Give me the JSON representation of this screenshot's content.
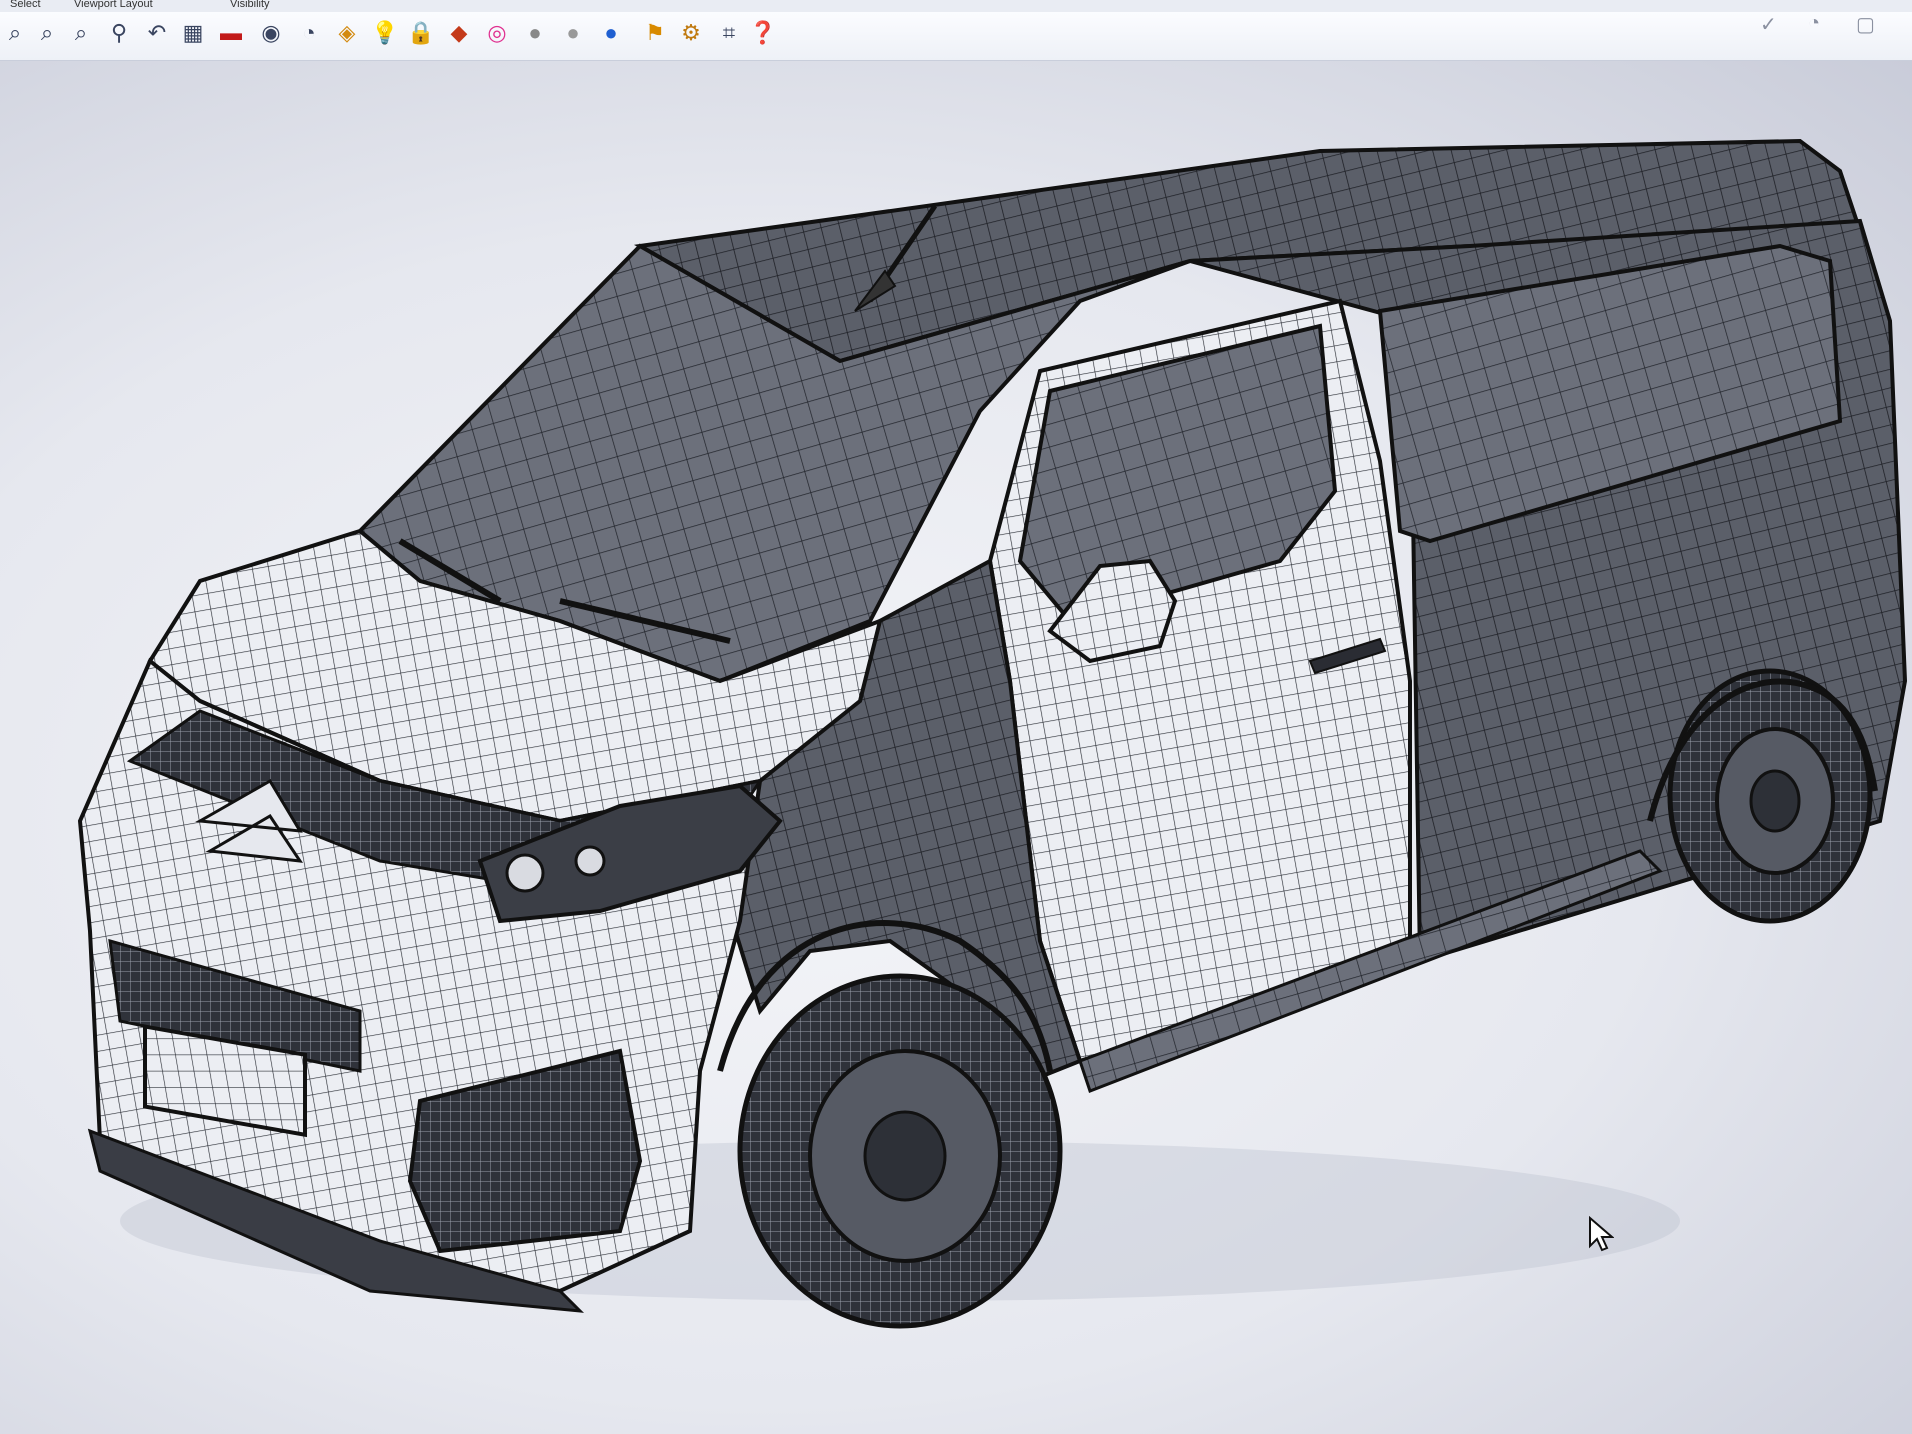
{
  "menu": {
    "select": "Select",
    "viewport_layout": "Viewport Layout",
    "visibility": "Visibility"
  },
  "toolbar": {
    "icons": [
      "zoom-window-icon",
      "zoom-extents-icon",
      "zoom-selected-icon",
      "zoom-dynamic-icon",
      "undo-view-icon",
      "four-viewports-icon",
      "car-icon",
      "hide-icon",
      "show-icon",
      "layer-icon",
      "light-bulb-icon",
      "lock-icon",
      "material-icon",
      "color-wheel-icon",
      "shaded-sphere-icon",
      "rendered-sphere-icon",
      "blue-sphere-icon",
      "flag-icon",
      "options-gear-icon",
      "grid-snap-icon",
      "help-icon"
    ]
  },
  "viewport": {
    "object": "van-wireframe-mesh"
  },
  "colors": {
    "mesh_dark": "#2c2f36",
    "mesh_light": "#e9ebf0",
    "background": "#dfe3ec",
    "accent_blue": "#1f5fd1"
  }
}
